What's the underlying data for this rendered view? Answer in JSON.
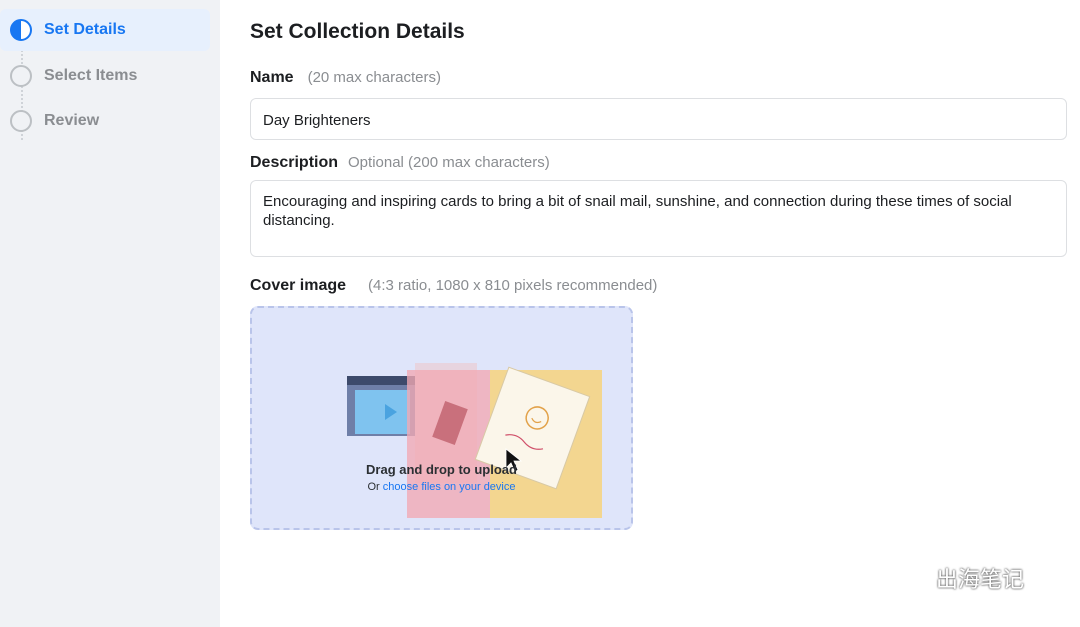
{
  "steps": [
    {
      "label": "Set Details",
      "active": true
    },
    {
      "label": "Select Items",
      "active": false
    },
    {
      "label": "Review",
      "active": false
    }
  ],
  "page_title": "Set Collection Details",
  "name_field": {
    "label": "Name",
    "hint": "(20 max characters)",
    "value": "Day Brighteners"
  },
  "description_field": {
    "label": "Description",
    "hint": "Optional (200 max characters)",
    "value": "Encouraging and inspiring cards to bring a bit of snail mail, sunshine, and connection during these times of social distancing."
  },
  "cover_image": {
    "label": "Cover image",
    "hint": "(4:3 ratio, 1080 x 810 pixels recommended)",
    "drop_text": "Drag and drop to upload",
    "or_text": "Or",
    "choose_link": "choose files on your device"
  },
  "watermark": {
    "text": "出海笔记"
  },
  "colors": {
    "accent": "#1877f2",
    "sidebar_bg": "#f0f2f5",
    "upload_bg": "#dfe5fa"
  }
}
